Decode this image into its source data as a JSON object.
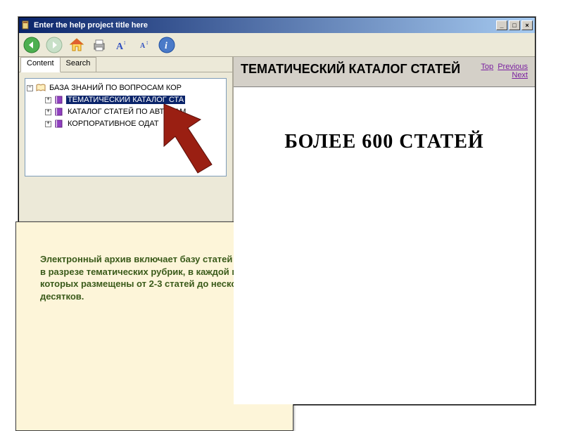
{
  "titlebar": {
    "title": "Enter the help project title here"
  },
  "winbuttons": {
    "min": "_",
    "max": "□",
    "close": "×"
  },
  "tabs": {
    "content": "Content",
    "search": "Search"
  },
  "tree": {
    "root": "БАЗА ЗНАНИЙ ПО ВОПРОСАМ КОР",
    "item1": "ТЕМАТИЧЕСКИЙ КАТАЛОГ СТА",
    "item2": "КАТАЛОГ СТАТЕЙ ПО АВТОРАМ",
    "item3": "КОРПОРАТИВНОЕ                ОДАТ"
  },
  "tooltip": "Электронный архив включает базу статей журнала в разрезе тематических рубрик, в каждой из которых размещены от 2-3 статей до нескольких десятков.",
  "content": {
    "heading": "ТЕМАТИЧЕСКИЙ КАТАЛОГ СТАТЕЙ",
    "navlinks": {
      "top": "Top",
      "previous": "Previous",
      "next": "Next"
    },
    "bigtext": "БОЛЕЕ 600 СТАТЕЙ"
  }
}
